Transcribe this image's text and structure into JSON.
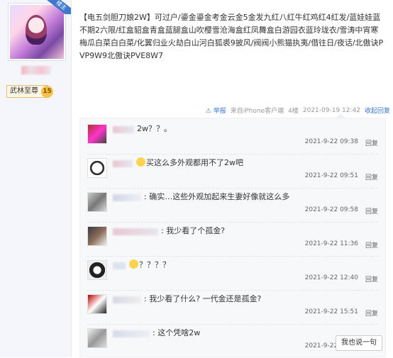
{
  "sidebar": {
    "tag": "楼主",
    "level_name": "武林至尊",
    "level_number": "15"
  },
  "post": {
    "content": "【电五剑胆刀娘2W】可过户/鎏金鎏金考金云金5金发九红八红牛红鸡红4红发/蓝娃娃蓝不期2六限/红盒貂盒青盒蓝腿盒山吹樱雪沧海盒红凤舞盒白游园衣蓝玲珑衣/雪涛中宵寒梅瓜白菜白白菜/化翼归业火劫白山河白狐裘9披风/阀阀小熊猫执夷/借往日/夜话/北傲诀PVP9W9北傲诀PVE8W7",
    "report": "举报",
    "source": "来自iPhone客户端",
    "floor": "4楼",
    "time": "2021-09-19 12:42",
    "collapse": "收起回复"
  },
  "replies": [
    {
      "text": "2w？？。",
      "time": "2021-9-22 09:38",
      "reply": "回复"
    },
    {
      "text": "买这么多外观都用不了2w吧",
      "time": "2021-9-22 09:51",
      "reply": "回复"
    },
    {
      "text": ": 确实…这些外观加起来生妻好像就这么多",
      "time": "2021-9-22 09:58",
      "reply": "回复"
    },
    {
      "text": ": 我少看了个孤金?",
      "time": "2021-9-22 11:36",
      "reply": "回复"
    },
    {
      "text": "？？？？",
      "time": "2021-9-22 12:40",
      "reply": "回复"
    },
    {
      "text": ": 我少看了什么? 一代金还是孤金?",
      "time": "2021-9-22 15:51",
      "reply": "回复"
    },
    {
      "text": ": 这个凭啥2w",
      "time": "2021-9-22 16:44",
      "reply": "回复"
    }
  ],
  "say_button": "我也说一句"
}
